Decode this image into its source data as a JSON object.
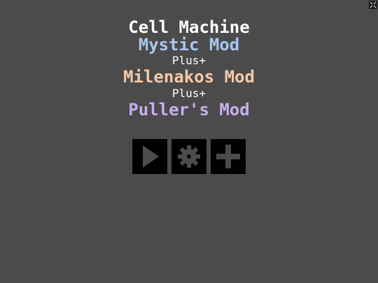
{
  "colors": {
    "background": "#4b4b4b",
    "title": "#ffffff",
    "mystic": "#a8c7f0",
    "plus": "#ffffff",
    "milenakos": "#f5c9a8",
    "puller": "#c7aef0",
    "button_frame": "#000000",
    "button_icon": "#4b4b4b"
  },
  "menu": {
    "title": "Cell Machine",
    "mod1": "Mystic Mod",
    "plus1": "Plus+",
    "mod2": "Milenakos Mod",
    "plus2": "Plus+",
    "mod3": "Puller's Mod"
  },
  "buttons": [
    {
      "icon": "play-icon"
    },
    {
      "icon": "gear-icon"
    },
    {
      "icon": "plus-icon"
    }
  ],
  "corner": {
    "icon": "fullscreen-icon"
  }
}
